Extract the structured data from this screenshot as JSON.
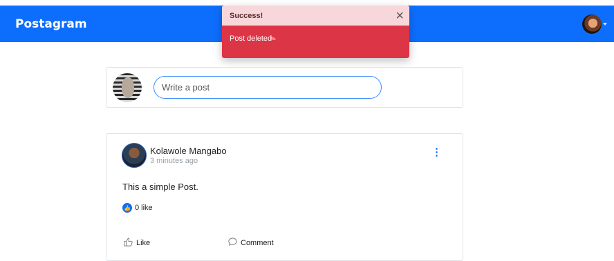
{
  "navbar": {
    "brand": "Postagram"
  },
  "toast": {
    "title": "Success!",
    "close_glyph": "×",
    "message": "Post deleted",
    "message_icon": "pin-icon"
  },
  "composer": {
    "placeholder": "Write a post",
    "value": ""
  },
  "post": {
    "author": "Kolawole Mangabo",
    "time_ago": "3 minutes ago",
    "text": "This a simple Post.",
    "like_count_label": "0 like",
    "more_glyph": "⋮",
    "like_label": "Like",
    "comment_label": "Comment"
  },
  "colors": {
    "primary": "#0d6efd",
    "danger": "#dc3545",
    "toast_header": "#f8d7da"
  }
}
